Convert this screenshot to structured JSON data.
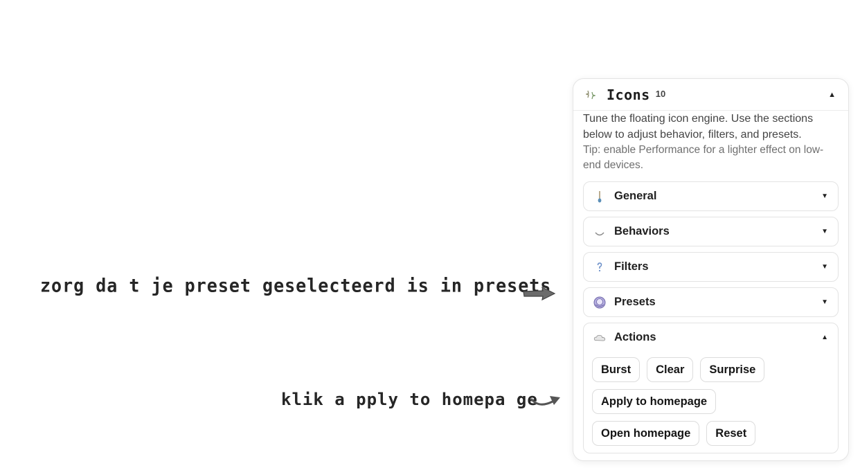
{
  "annotations": {
    "select_preset": "zorg da t je preset geselecteerd is in presets",
    "apply_home": "klik a pply to homepa ge"
  },
  "panel": {
    "title": "Icons",
    "count": "10",
    "description": "Tune the floating icon engine. Use the sections below to adjust behavior, filters, and presets.",
    "tip": "Tip: enable Performance for a lighter effect on low-end devices.",
    "header_icon": "sparkle-icon",
    "sections": [
      {
        "label": "General",
        "icon": "brush-icon",
        "expanded": false
      },
      {
        "label": "Behaviors",
        "icon": "swirl-icon",
        "expanded": false
      },
      {
        "label": "Filters",
        "icon": "question-icon",
        "expanded": false
      },
      {
        "label": "Presets",
        "icon": "orb-icon",
        "expanded": false
      },
      {
        "label": "Actions",
        "icon": "cloud-icon",
        "expanded": true
      }
    ],
    "actions": {
      "burst": "Burst",
      "clear": "Clear",
      "surprise": "Surprise",
      "apply_homepage": "Apply to homepage",
      "open_homepage": "Open homepage",
      "reset": "Reset"
    }
  },
  "colors": {
    "text": "#1f1f1f",
    "border": "#e3e3e3",
    "orb": "#8f86c4"
  }
}
